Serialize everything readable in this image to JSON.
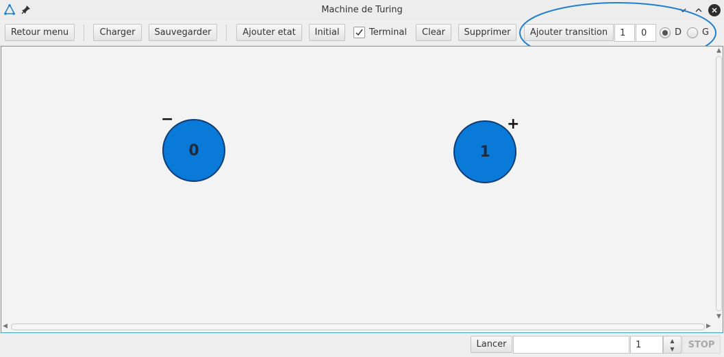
{
  "window": {
    "title": "Machine de Turing"
  },
  "toolbar": {
    "retour_menu": "Retour menu",
    "charger": "Charger",
    "sauvegarder": "Sauvegarder",
    "ajouter_etat": "Ajouter etat",
    "initial": "Initial",
    "terminal_label": "Terminal",
    "terminal_checked": true,
    "clear": "Clear",
    "supprimer": "Supprimer",
    "ajouter_transition": "Ajouter transition",
    "read_symbol": "1",
    "write_symbol": "0",
    "direction_d": "D",
    "direction_g": "G",
    "selected_direction": "D"
  },
  "canvas": {
    "states": [
      {
        "label": "0",
        "marker": "−"
      },
      {
        "label": "1",
        "marker": "+"
      }
    ]
  },
  "bottom": {
    "lancer": "Lancer",
    "input_value": "",
    "speed_value": "1",
    "stop": "STOP"
  },
  "colors": {
    "state_fill": "#0a7ad8",
    "state_border": "#0d3b75",
    "highlight": "#1f7fd0",
    "canvas_border": "#3aa3c8"
  }
}
